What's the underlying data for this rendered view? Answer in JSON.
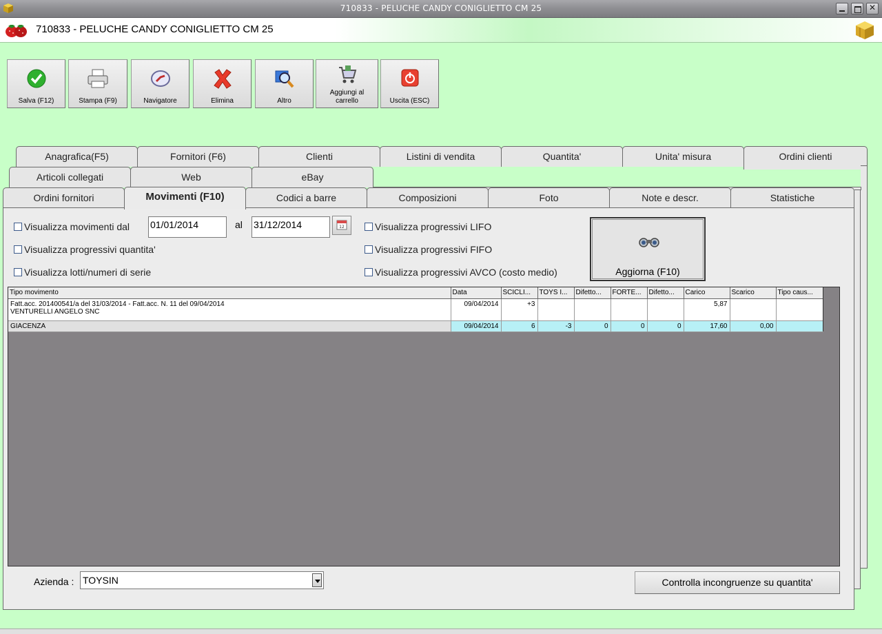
{
  "window": {
    "title": "710833 - PELUCHE CANDY CONIGLIETTO CM 25"
  },
  "header": {
    "title": "710833 - PELUCHE CANDY CONIGLIETTO CM 25"
  },
  "toolbar": [
    {
      "label": "Salva (F12)",
      "icon": "checkmark-icon"
    },
    {
      "label": "Stampa (F9)",
      "icon": "printer-icon"
    },
    {
      "label": "Navigatore",
      "icon": "compass-icon"
    },
    {
      "label": "Elimina",
      "icon": "red-x-icon"
    },
    {
      "label": "Altro",
      "icon": "magnifier-icon"
    },
    {
      "label": "Aggiungi al carrello",
      "icon": "cart-icon"
    },
    {
      "label": "Uscita (ESC)",
      "icon": "power-icon"
    }
  ],
  "tabs": {
    "row1": [
      "Anagrafica(F5)",
      "Fornitori (F6)",
      "Clienti",
      "Listini di vendita",
      "Quantita'",
      "Unita' misura",
      "Ordini clienti"
    ],
    "row2": [
      "Articoli collegati",
      "Web",
      "eBay"
    ],
    "row3": [
      "Ordini fornitori",
      "Movimenti (F10)",
      "Codici a barre",
      "Composizioni",
      "Foto",
      "Note e descr.",
      "Statistiche"
    ],
    "active": "Movimenti (F10)"
  },
  "filters": {
    "show_movements_label": "Visualizza movimenti dal",
    "date_from": "01/01/2014",
    "al_label": "al",
    "date_to": "31/12/2014",
    "progressive_qty_label": "Visualizza progressivi quantita'",
    "lots_label": "Visualizza lotti/numeri di serie",
    "lifo_label": "Visualizza progressivi LIFO",
    "fifo_label": "Visualizza progressivi FIFO",
    "avco_label": "Visualizza progressivi AVCO (costo medio)",
    "refresh_label": "Aggiorna (F10)"
  },
  "grid": {
    "columns": [
      "Tipo movimento",
      "Data",
      "SCICLI...",
      "TOYS I...",
      "Difetto...",
      "FORTE...",
      "Difetto...",
      "Carico",
      "Scarico",
      "Tipo caus..."
    ],
    "rows": [
      {
        "tipo_line1": "Fatt.acc. 201400541/a del 31/03/2014 - Fatt.acc. N. 11 del 09/04/2014",
        "tipo_line2": "VENTURELLI ANGELO SNC",
        "data": "09/04/2014",
        "c1": "+3",
        "c2": "",
        "c3": "",
        "c4": "",
        "c5": "",
        "carico": "5,87",
        "scarico": "",
        "tipo_caus": ""
      },
      {
        "tipo_line1": "GIACENZA",
        "tipo_line2": "",
        "data": "09/04/2014",
        "c1": "6",
        "c2": "-3",
        "c3": "0",
        "c4": "0",
        "c5": "0",
        "carico": "17,60",
        "scarico": "0,00",
        "tipo_caus": ""
      }
    ]
  },
  "footer": {
    "azienda_label": "Azienda :",
    "azienda_value": "TOYSIN",
    "check_button_label": "Controlla incongruenze su quantita'"
  }
}
